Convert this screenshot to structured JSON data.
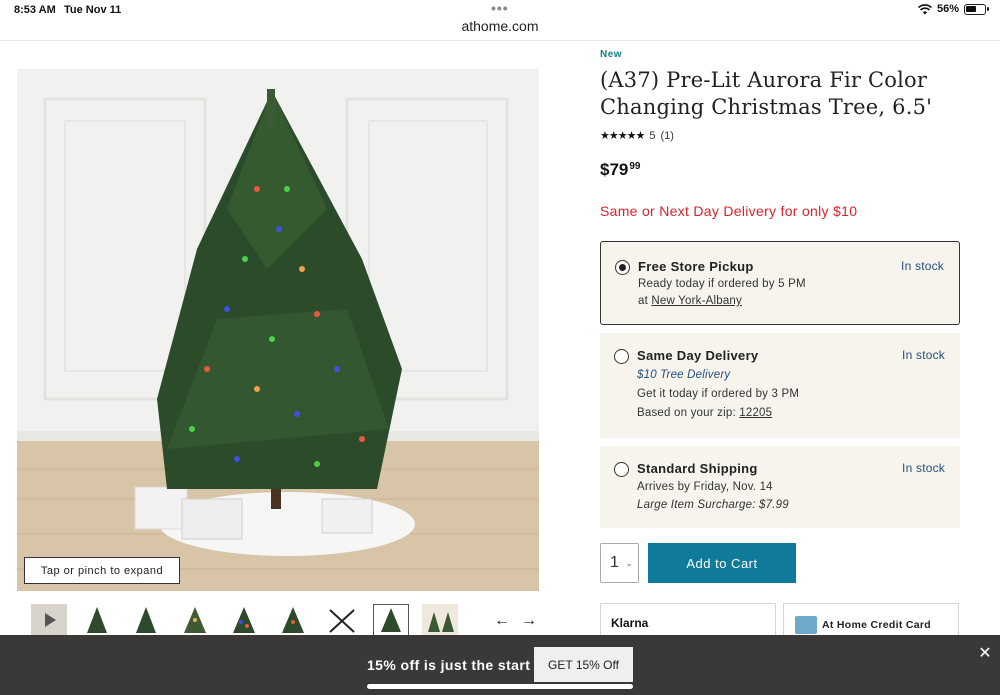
{
  "status_bar": {
    "time": "8:53 AM",
    "date": "Tue Nov 11",
    "battery": "56%"
  },
  "browser": {
    "url": "athome.com"
  },
  "product": {
    "badge": "New",
    "title": "(A37) Pre-Lit Aurora Fir Color Changing Christmas Tree, 6.5'",
    "rating_value": "5",
    "rating_count": "(1)",
    "rating_stars": "★★★★★",
    "price_dollars": "$79",
    "price_cents": "99",
    "delivery_promo": "Same or Next Day Delivery for only $10",
    "image_hint": "Tap or pinch to expand"
  },
  "fulfillment": [
    {
      "title": "Free Store Pickup",
      "stock": "In stock",
      "line1": "Ready today if ordered by 5 PM",
      "line2_prefix": "at ",
      "line2_link": "New York-Albany"
    },
    {
      "title": "Same Day Delivery",
      "stock": "In stock",
      "line1": "$10 Tree Delivery",
      "line2": "Get it today if ordered by 3 PM",
      "line3_prefix": "Based on your zip: ",
      "line3_link": "12205"
    },
    {
      "title": "Standard Shipping",
      "stock": "In stock",
      "line1": "Arrives by Friday, Nov. 14",
      "line2": "Large Item Surcharge: $7.99"
    }
  ],
  "cart": {
    "quantity": "1",
    "add_label": "Add to Cart"
  },
  "payment": {
    "klarna": "Klarna",
    "credit_card": "At Home Credit Card"
  },
  "promo": {
    "text": "15% off is just the start",
    "button": "GET 15% Off",
    "close": "✕"
  },
  "icons": {
    "prev": "←",
    "next": "→",
    "chevron": "⌄"
  },
  "colors": {
    "accent_teal": "#107a9a",
    "promo_red": "#d8232a",
    "stock_blue": "#24507a",
    "option_bg": "#f7f4ee",
    "promo_bar": "#3b3937"
  }
}
